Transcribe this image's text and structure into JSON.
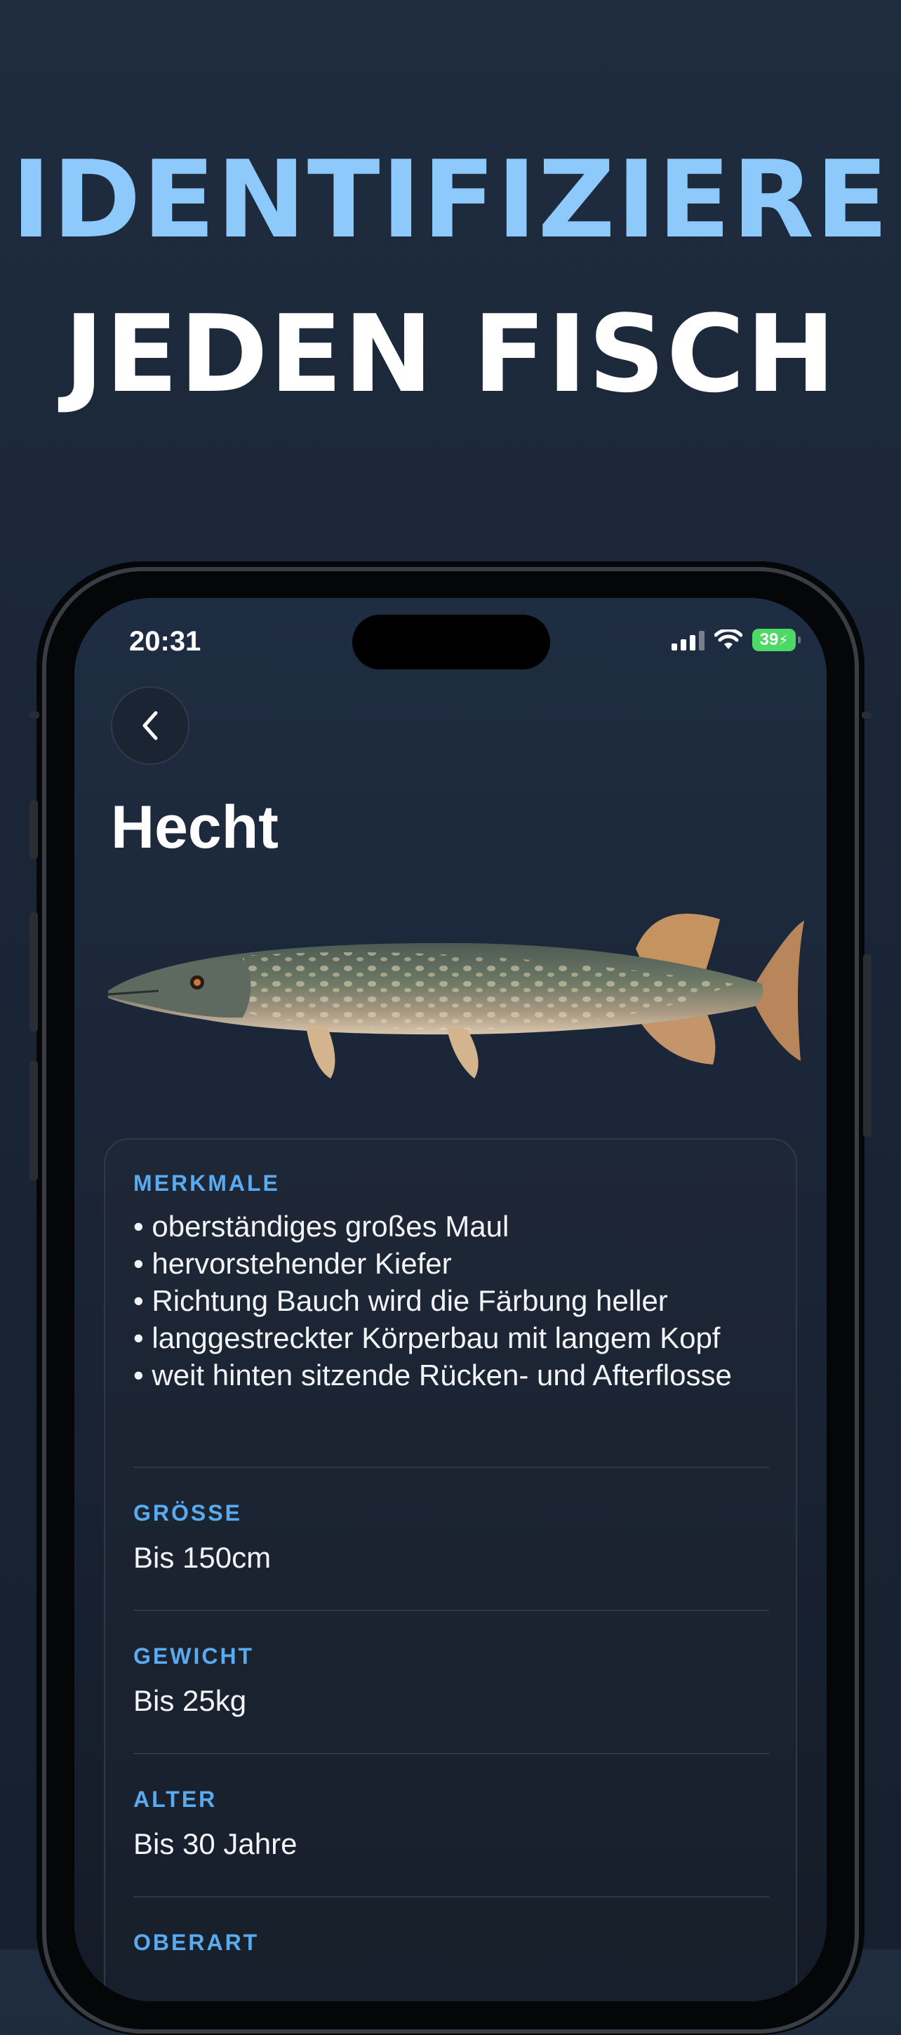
{
  "headline": {
    "line1": "IDENTIFIZIERE",
    "line2": "JEDEN FISCH"
  },
  "status_bar": {
    "time": "20:31",
    "battery": "39"
  },
  "nav": {
    "back_icon": "chevron-left-icon"
  },
  "fish": {
    "name": "Hecht"
  },
  "details": {
    "merkmale": {
      "label": "MERKMALE",
      "value": "• oberständiges großes Maul\n• hervorstehender Kiefer\n• Richtung Bauch wird die Färbung heller\n• langgestreckter Körperbau mit langem Kopf\n• weit hinten sitzende Rücken- und Afterflosse"
    },
    "groesse": {
      "label": "GRÖSSE",
      "value": "Bis 150cm"
    },
    "gewicht": {
      "label": "GEWICHT",
      "value": "Bis 25kg"
    },
    "alter": {
      "label": "ALTER",
      "value": "Bis 30 Jahre"
    },
    "oberart": {
      "label": "OBERART"
    }
  },
  "colors": {
    "headline_accent": "#8ec9fb",
    "section_label": "#5aaaf0",
    "battery": "#4cd964"
  }
}
